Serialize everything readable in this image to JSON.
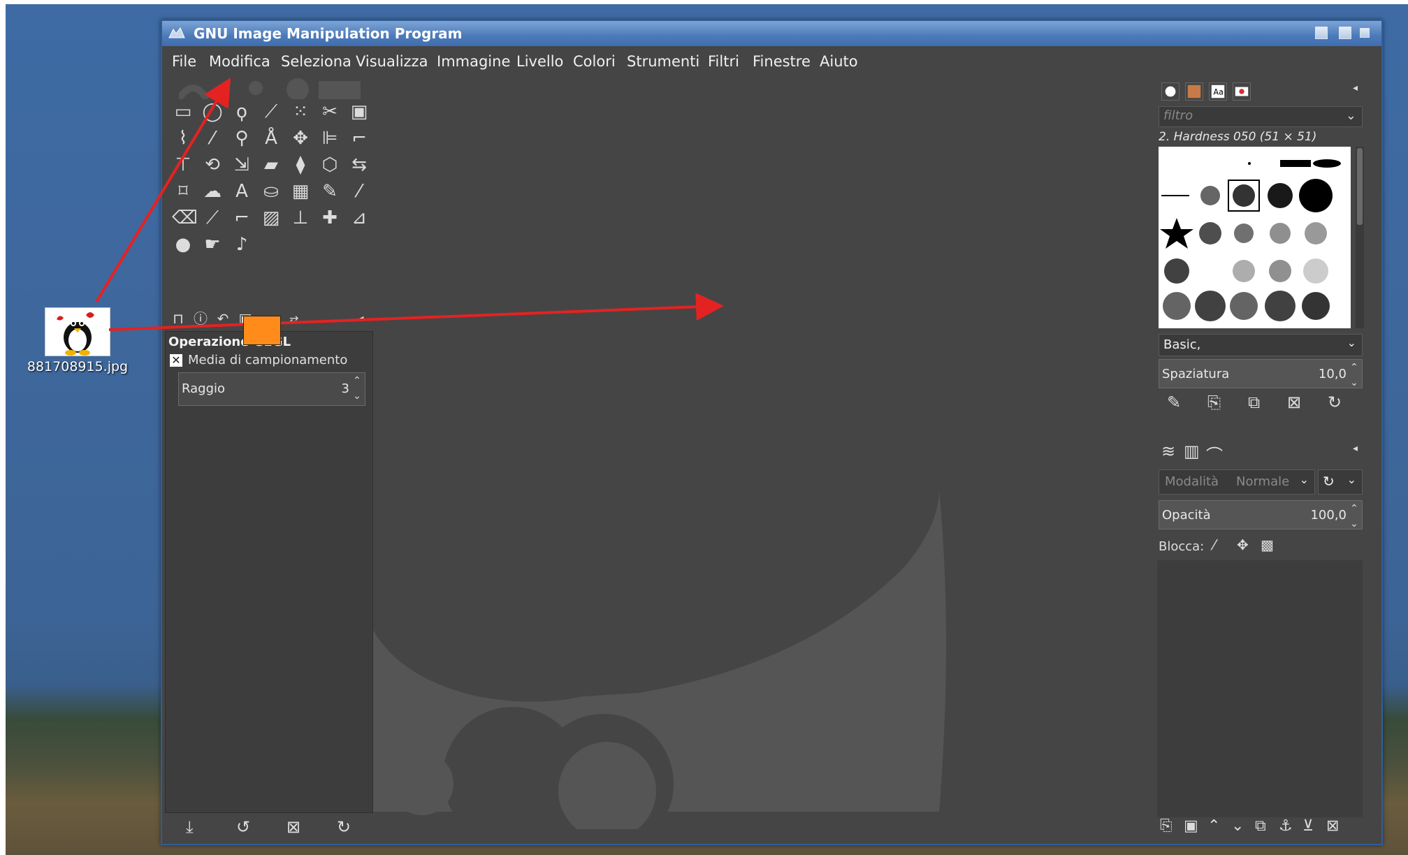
{
  "window": {
    "title": "GNU Image Manipulation Program"
  },
  "menubar": {
    "items": [
      "File",
      "Modifica",
      "Seleziona",
      "Visualizza",
      "Immagine",
      "Livello",
      "Colori",
      "Strumenti",
      "Filtri",
      "Finestre",
      "Aiuto"
    ]
  },
  "desktop": {
    "file_label": "881708915.jpg"
  },
  "tool_options": {
    "title": "Operazione GEGL",
    "operation": "Media di campionamento",
    "radius_label": "Raggio",
    "radius_value": "3"
  },
  "brushes": {
    "filter_placeholder": "filtro",
    "selected_brush": "2. Hardness 050 (51 × 51)",
    "preset": "Basic,",
    "spacing_label": "Spaziatura",
    "spacing_value": "10,0"
  },
  "layers": {
    "mode_label": "Modalità",
    "mode_value": "Normale",
    "opacity_label": "Opacità",
    "opacity_value": "100,0",
    "lock_label": "Blocca:"
  },
  "colors": {
    "foreground": "#ff8c1a",
    "background": "#ffffff",
    "annotation_arrow": "#e52222"
  }
}
